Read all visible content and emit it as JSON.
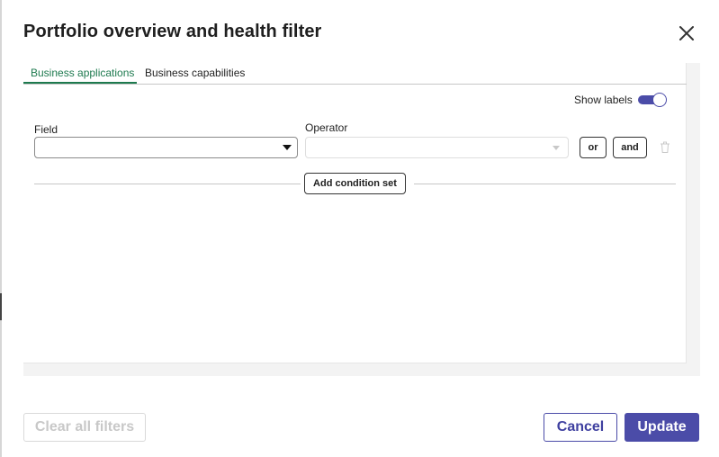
{
  "dialog": {
    "title": "Portfolio overview and health filter",
    "close_icon": "close-icon"
  },
  "tabs": [
    {
      "label": "Business applications",
      "active": true
    },
    {
      "label": "Business capabilities",
      "active": false
    }
  ],
  "show_labels": {
    "label": "Show labels",
    "enabled": true
  },
  "condition": {
    "field_label": "Field",
    "field_value": "",
    "operator_label": "Operator",
    "operator_value": "",
    "operator_disabled": true,
    "or_label": "or",
    "and_label": "and",
    "delete_icon": "trash-icon"
  },
  "add_condition_set_label": "Add condition set",
  "footer": {
    "clear_label": "Clear all filters",
    "clear_disabled": true,
    "cancel_label": "Cancel",
    "update_label": "Update"
  },
  "colors": {
    "accent": "#4b4ca8",
    "active_tab": "#1e7a4f",
    "disabled_text": "#c8c8c8"
  }
}
